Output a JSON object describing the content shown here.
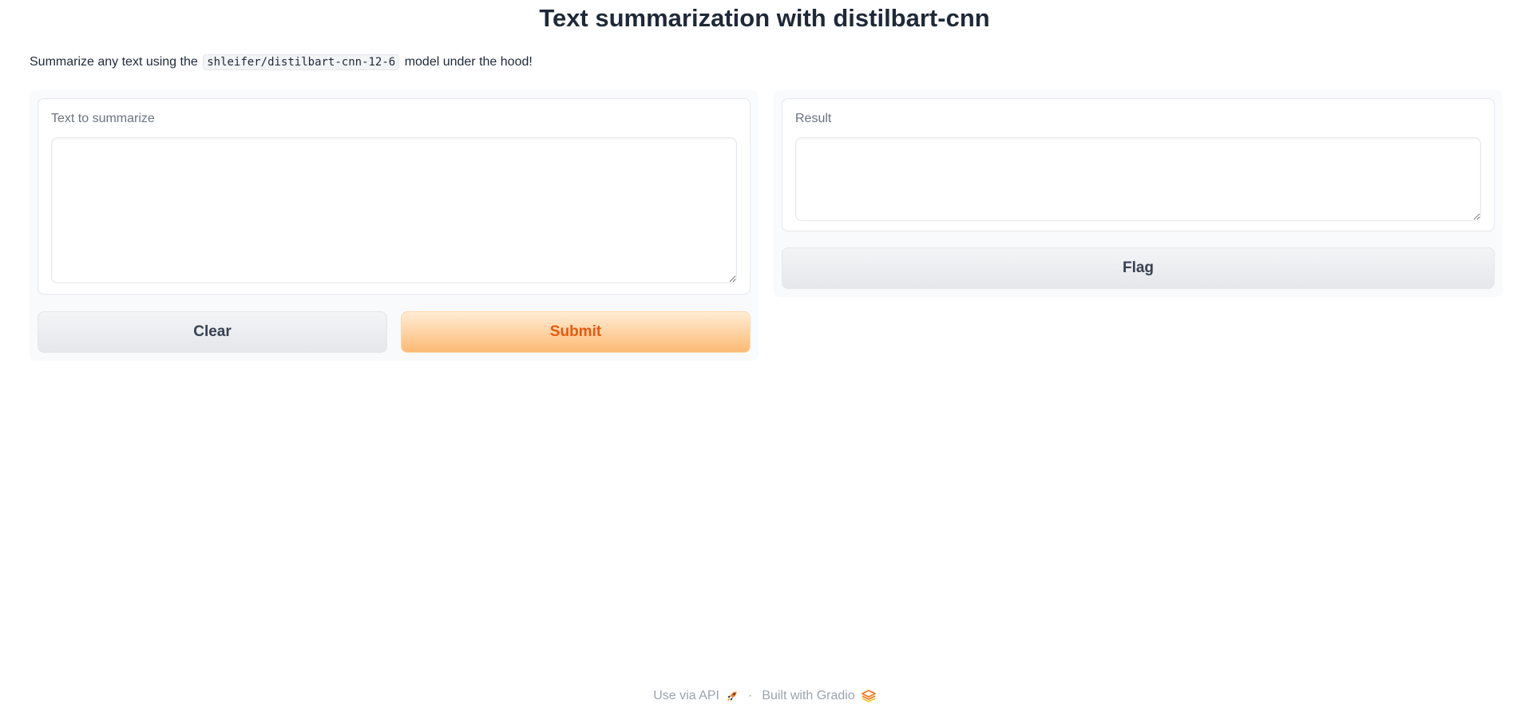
{
  "header": {
    "title": "Text summarization with distilbart-cnn"
  },
  "description": {
    "before": "Summarize any text using the",
    "code": "shleifer/distilbart-cnn-12-6",
    "after": "model under the hood!"
  },
  "input_panel": {
    "label": "Text to summarize",
    "value": "",
    "placeholder": ""
  },
  "output_panel": {
    "label": "Result",
    "value": "",
    "placeholder": ""
  },
  "buttons": {
    "clear_label": "Clear",
    "submit_label": "Submit",
    "flag_label": "Flag"
  },
  "footer": {
    "api_label": "Use via API",
    "separator": "·",
    "built_label": "Built with Gradio"
  },
  "icons": {
    "api": "rocket-icon",
    "gradio": "gradio-logo-icon"
  },
  "colors": {
    "primary_text": "#ea580c",
    "primary_bg_start": "#ffedd5",
    "primary_bg_end": "#fdba74",
    "secondary_bg": "#e5e7eb",
    "panel_bg": "#f9fafb"
  }
}
